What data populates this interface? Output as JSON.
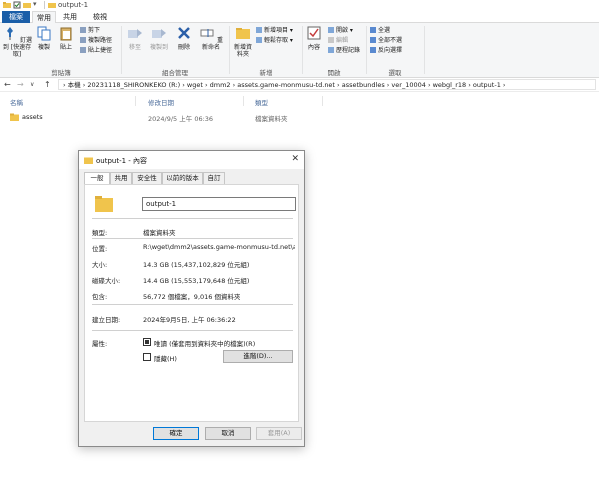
{
  "window": {
    "title": "output-1"
  },
  "ribbon_tabs": [
    "檔案",
    "常用",
    "共用",
    "檢視"
  ],
  "ribbon": {
    "clipboard": {
      "pin": "釘選到 [快速存取]",
      "copy": "複製",
      "paste": "貼上",
      "cut": "剪下",
      "copy_path": "複製路徑",
      "paste_shortcut": "貼上捷徑",
      "label": "剪貼簿"
    },
    "organize": {
      "move_to": "移至",
      "copy_to": "複製到",
      "delete": "刪除",
      "rename": "重新命名",
      "label": "組合管理"
    },
    "new": {
      "new_folder": "新增資料夾",
      "new_item": "新增項目",
      "easy_access": "輕鬆存取",
      "label": "新增"
    },
    "open": {
      "properties": "內容",
      "open": "開啟",
      "edit": "編輯",
      "history": "歷程記錄",
      "label": "開啟"
    },
    "select": {
      "select_all": "全選",
      "select_none": "全部不選",
      "invert": "反向選擇",
      "label": "選取"
    }
  },
  "address": {
    "path": "›  本機  ›  20231118_SHIRONKEKO (R:)  ›  wget  ›  dmm2  ›  assets.game-monmusu-td.net  ›  assetbundles  ›  ver_10004  ›  webgl_r18  ›  output-1  ›"
  },
  "columns": {
    "name": "名稱",
    "modified": "修改日期",
    "type": "類型"
  },
  "files": [
    {
      "name": "assets",
      "modified": "2024/9/5 上午 06:36",
      "type": "檔案資料夾"
    }
  ],
  "dialog": {
    "title": "output-1 - 內容",
    "tabs": [
      "一般",
      "共用",
      "安全性",
      "以前的版本",
      "自訂"
    ],
    "name": "output-1",
    "type_label": "類型:",
    "type_value": "檔案資料夾",
    "location_label": "位置:",
    "location_value": "R:\\wget\\dmm2\\assets.game-monmusu-td.net\\asse",
    "size_label": "大小:",
    "size_value": "14.3 GB (15,437,102,829 位元組)",
    "disk_size_label": "磁碟大小:",
    "disk_size_value": "14.4 GB (15,553,179,648 位元組)",
    "contains_label": "包含:",
    "contains_value": "56,772 個檔案，9,016 個資料夾",
    "created_label": "建立日期:",
    "created_value": "2024年9月5日, 上午 06:36:22",
    "attributes_label": "屬性:",
    "readonly_label": "唯讀 (僅套用到資料夾中的檔案)(R)",
    "hidden_label": "隱藏(H)",
    "advanced_button": "進階(D)...",
    "ok_button": "確定",
    "cancel_button": "取消",
    "apply_button": "套用(A)"
  },
  "colors": {
    "file_tab": "#1a5ea8",
    "folder": "#f0c44c",
    "accent": "#0078d7"
  }
}
